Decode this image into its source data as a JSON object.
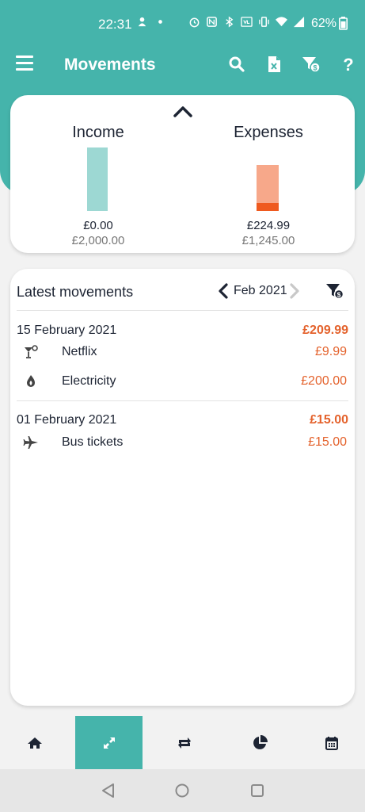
{
  "status_bar": {
    "time": "22:31",
    "battery": "62%"
  },
  "app_bar": {
    "title": "Movements",
    "icons": [
      "menu-icon",
      "search-icon",
      "excel-export-icon",
      "filter-money-icon",
      "help-icon"
    ]
  },
  "summary": {
    "income": {
      "title": "Income",
      "value": "£0.00",
      "target": "£2,000.00",
      "progress": 0.0,
      "color": "#9dd8d3"
    },
    "expenses": {
      "title": "Expenses",
      "value": "£224.99",
      "target": "£1,245.00",
      "progress": 0.18,
      "color": "#f7a88a",
      "fill_color": "#ef5a1f"
    }
  },
  "movements": {
    "title": "Latest movements",
    "month": "Feb 2021",
    "days": [
      {
        "date": "15 February 2021",
        "total": "£209.99",
        "items": [
          {
            "name": "Netflix",
            "amount": "£9.99",
            "icon": "cocktail-icon"
          },
          {
            "name": "Electricity",
            "amount": "£200.00",
            "icon": "flame-icon"
          }
        ]
      },
      {
        "date": "01 February 2021",
        "total": "£15.00",
        "items": [
          {
            "name": "Bus tickets",
            "amount": "£15.00",
            "icon": "plane-icon"
          }
        ]
      }
    ]
  },
  "bottom_nav": {
    "items": [
      "home-icon",
      "movements-icon",
      "recurring-icon",
      "stats-icon",
      "calendar-icon"
    ],
    "active": "movements-icon"
  },
  "colors": {
    "accent": "#45b4ab",
    "expense": "#e4622c",
    "text": "#1d2433"
  }
}
